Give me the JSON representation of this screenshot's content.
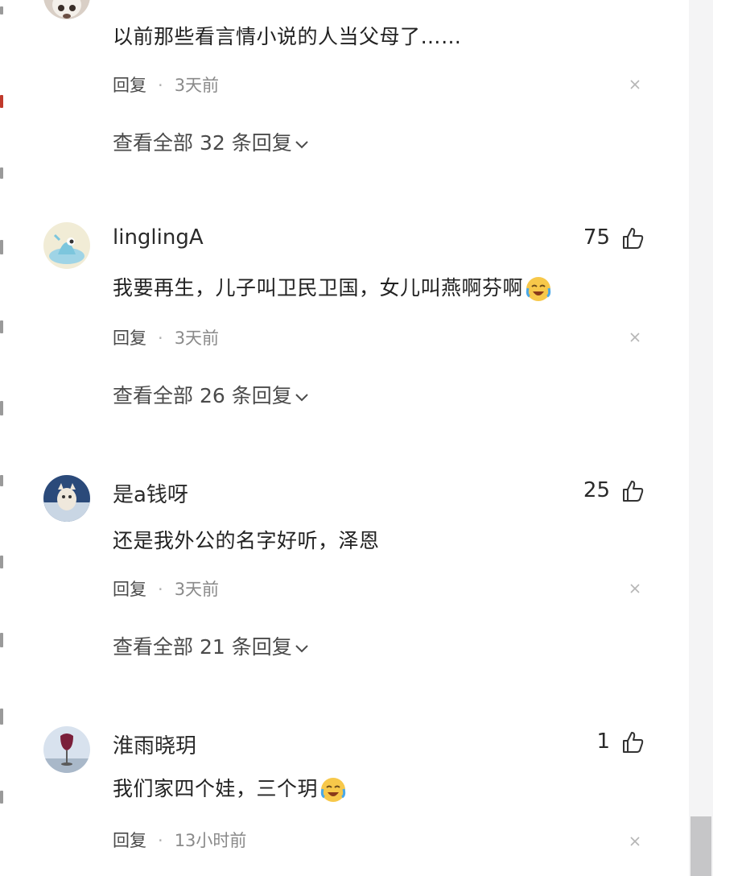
{
  "comments": [
    {
      "username": "",
      "likes": "",
      "text": "以前那些看言情小说的人当父母了……",
      "reply_label": "回复",
      "time": "3天前",
      "view_replies": "查看全部 32 条回复"
    },
    {
      "username": "linglingA",
      "likes": "75",
      "text": "我要再生，儿子叫卫民卫国，女儿叫燕啊芬啊",
      "reply_label": "回复",
      "time": "3天前",
      "view_replies": "查看全部 26 条回复"
    },
    {
      "username": "是a钱呀",
      "likes": "25",
      "text": "还是我外公的名字好听，泽恩",
      "reply_label": "回复",
      "time": "3天前",
      "view_replies": "查看全部 21 条回复"
    },
    {
      "username": "淮雨晓玥",
      "likes": "1",
      "text": "我们家四个娃，三个玥",
      "reply_label": "回复",
      "time": "13小时前",
      "view_replies": ""
    }
  ],
  "icons": {
    "like": "thumbs-up-icon",
    "close": "close-icon",
    "expand": "chevron-down-icon",
    "emoji": "crying-laughing-emoji"
  },
  "colors": {
    "text": "#222222",
    "meta": "#8a8a8a",
    "scrollbar": "#c6c6c8"
  }
}
